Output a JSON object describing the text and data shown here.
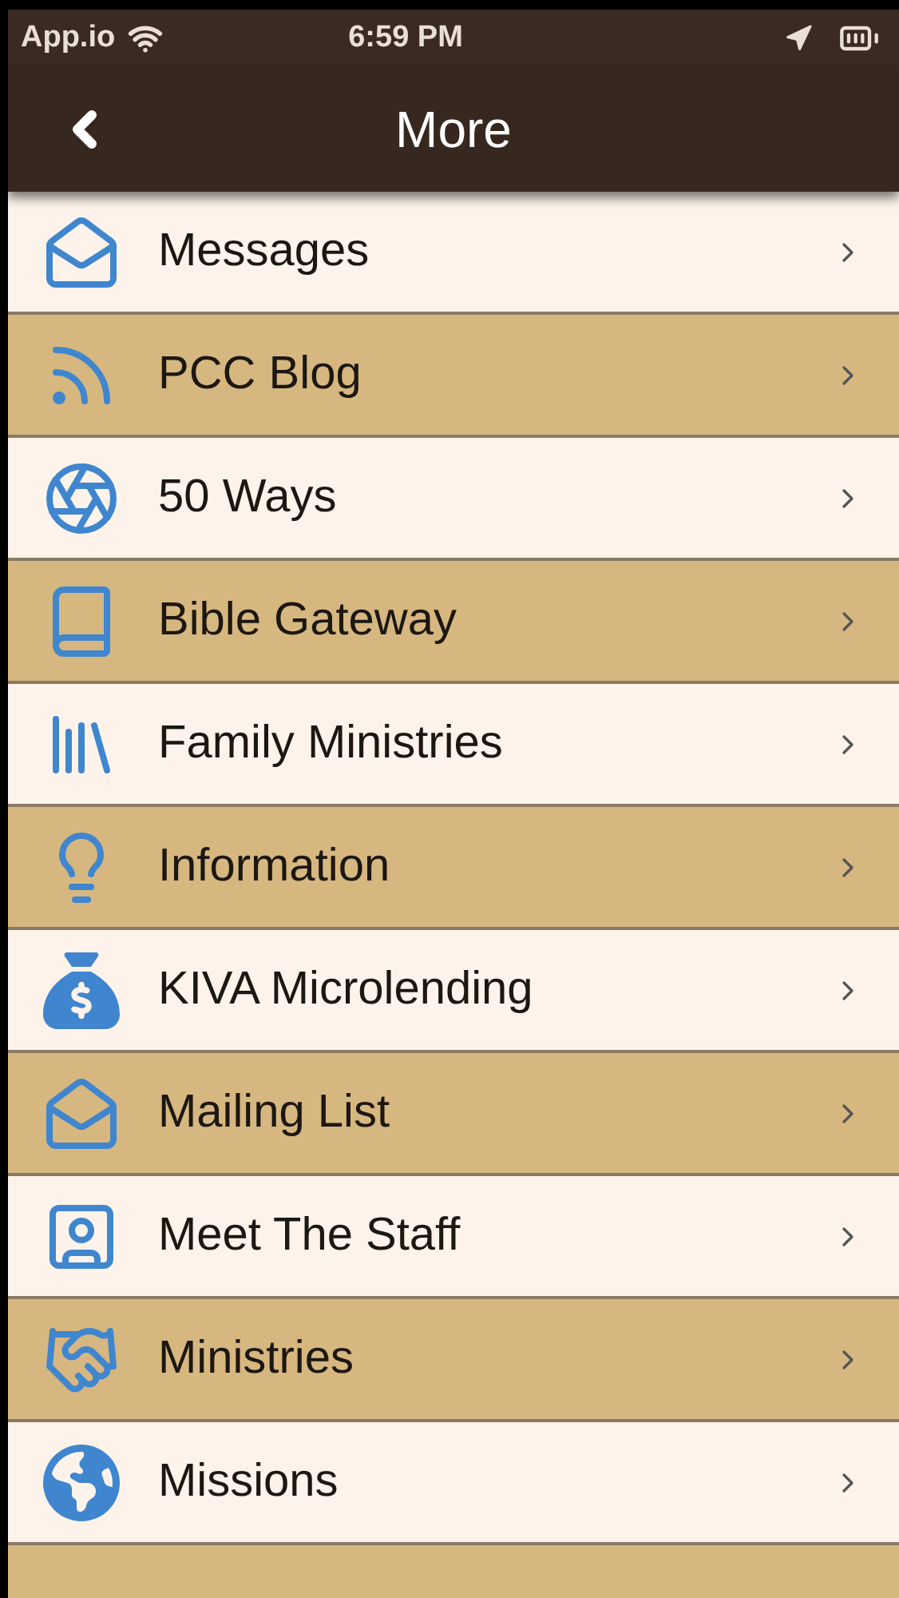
{
  "status_bar": {
    "carrier": "App.io",
    "time": "6:59 PM"
  },
  "nav_bar": {
    "title": "More"
  },
  "menu": [
    {
      "label": "Messages"
    },
    {
      "label": "PCC Blog"
    },
    {
      "label": "50 Ways"
    },
    {
      "label": "Bible Gateway"
    },
    {
      "label": "Family Ministries"
    },
    {
      "label": "Information"
    },
    {
      "label": "KIVA Microlending"
    },
    {
      "label": "Mailing List"
    },
    {
      "label": "Meet The Staff"
    },
    {
      "label": "Ministries"
    },
    {
      "label": "Missions"
    }
  ]
}
